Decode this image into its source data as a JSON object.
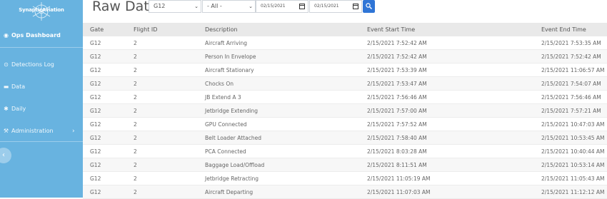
{
  "sidebar": {
    "brand": "SynapticAviation",
    "items": [
      {
        "label": "Ops Dashboard",
        "icon": "dashboard-icon",
        "active": true
      },
      {
        "label": "Detections Log",
        "icon": "detections-icon"
      },
      {
        "label": "Data",
        "icon": "folder-icon"
      },
      {
        "label": "Daily",
        "icon": "asterisk-icon"
      },
      {
        "label": "Administration",
        "icon": "wrench-icon"
      }
    ],
    "colors": {
      "background": "#68b3e0"
    }
  },
  "header": {
    "title": "Raw Data",
    "gate_select": "G12",
    "filter_select": "- All -",
    "start_date": "02/15/2021",
    "end_date": "02/15/2021",
    "search_button_color": "#2f75d6"
  },
  "table": {
    "columns": [
      "Gate",
      "Flight ID",
      "Description",
      "Event Start Time",
      "Event End Time"
    ],
    "rows": [
      [
        "G12",
        "2",
        "Aircraft Arriving",
        "2/15/2021 7:52:42 AM",
        "2/15/2021 7:53:35 AM"
      ],
      [
        "G12",
        "2",
        "Person In Envelope",
        "2/15/2021 7:52:42 AM",
        "2/15/2021 7:52:42 AM"
      ],
      [
        "G12",
        "2",
        "Aircraft Stationary",
        "2/15/2021 7:53:39 AM",
        "2/15/2021 11:06:57 AM"
      ],
      [
        "G12",
        "2",
        "Chocks On",
        "2/15/2021 7:53:47 AM",
        "2/15/2021 7:54:07 AM"
      ],
      [
        "G12",
        "2",
        "JB Extend A 3",
        "2/15/2021 7:56:46 AM",
        "2/15/2021 7:56:46 AM"
      ],
      [
        "G12",
        "2",
        "Jetbridge Extending",
        "2/15/2021 7:57:00 AM",
        "2/15/2021 7:57:21 AM"
      ],
      [
        "G12",
        "2",
        "GPU Connected",
        "2/15/2021 7:57:52 AM",
        "2/15/2021 10:47:03 AM"
      ],
      [
        "G12",
        "2",
        "Belt Loader Attached",
        "2/15/2021 7:58:40 AM",
        "2/15/2021 10:53:45 AM"
      ],
      [
        "G12",
        "2",
        "PCA Connected",
        "2/15/2021 8:03:28 AM",
        "2/15/2021 10:40:44 AM"
      ],
      [
        "G12",
        "2",
        "Baggage Load/Offload",
        "2/15/2021 8:11:51 AM",
        "2/15/2021 10:53:14 AM"
      ],
      [
        "G12",
        "2",
        "Jetbridge Retracting",
        "2/15/2021 11:05:19 AM",
        "2/15/2021 11:05:43 AM"
      ],
      [
        "G12",
        "2",
        "Aircraft Departing",
        "2/15/2021 11:07:03 AM",
        "2/15/2021 11:12:12 AM"
      ]
    ]
  }
}
